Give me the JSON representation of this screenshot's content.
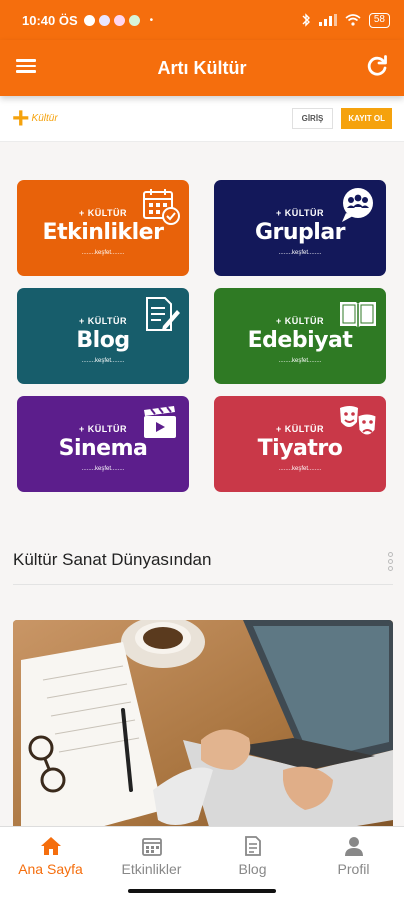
{
  "status_bar": {
    "time": "10:40 ÖS",
    "dot": "•",
    "battery": "58"
  },
  "app_bar": {
    "title": "Artı Kültür"
  },
  "site_header": {
    "logo_plus": "+",
    "logo_text": "Kültür",
    "login_label": "GİRİŞ",
    "register_label": "KAYIT OL"
  },
  "tiles": [
    {
      "prefix": "+ KÜLTÜR",
      "name": "Etkinlikler",
      "sub": "........keşfet........",
      "color": "#e8620a",
      "icon": "calendar-check-icon"
    },
    {
      "prefix": "+ KÜLTÜR",
      "name": "Gruplar",
      "sub": "........keşfet........",
      "color": "#13185a",
      "icon": "group-chat-icon"
    },
    {
      "prefix": "+ KÜLTÜR",
      "name": "Blog",
      "sub": "........keşfet........",
      "color": "#175d6b",
      "icon": "document-pen-icon"
    },
    {
      "prefix": "+ KÜLTÜR",
      "name": "Edebiyat",
      "sub": "........keşfet........",
      "color": "#2f7a24",
      "icon": "open-book-icon"
    },
    {
      "prefix": "+ KÜLTÜR",
      "name": "Sinema",
      "sub": "........keşfet........",
      "color": "#5c1e8c",
      "icon": "clapperboard-icon"
    },
    {
      "prefix": "+ KÜLTÜR",
      "name": "Tiyatro",
      "sub": "........keşfet........",
      "color": "#c93848",
      "icon": "theatre-masks-icon"
    }
  ],
  "section": {
    "title": "Kültür Sanat Dünyasından"
  },
  "bottom_nav": [
    {
      "label": "Ana Sayfa",
      "icon": "home-icon",
      "active": true
    },
    {
      "label": "Etkinlikler",
      "icon": "calendar-icon",
      "active": false
    },
    {
      "label": "Blog",
      "icon": "blog-icon",
      "active": false
    },
    {
      "label": "Profil",
      "icon": "user-icon",
      "active": false
    }
  ],
  "colors": {
    "brand": "#f56e0d",
    "accent": "#f5a20d"
  }
}
